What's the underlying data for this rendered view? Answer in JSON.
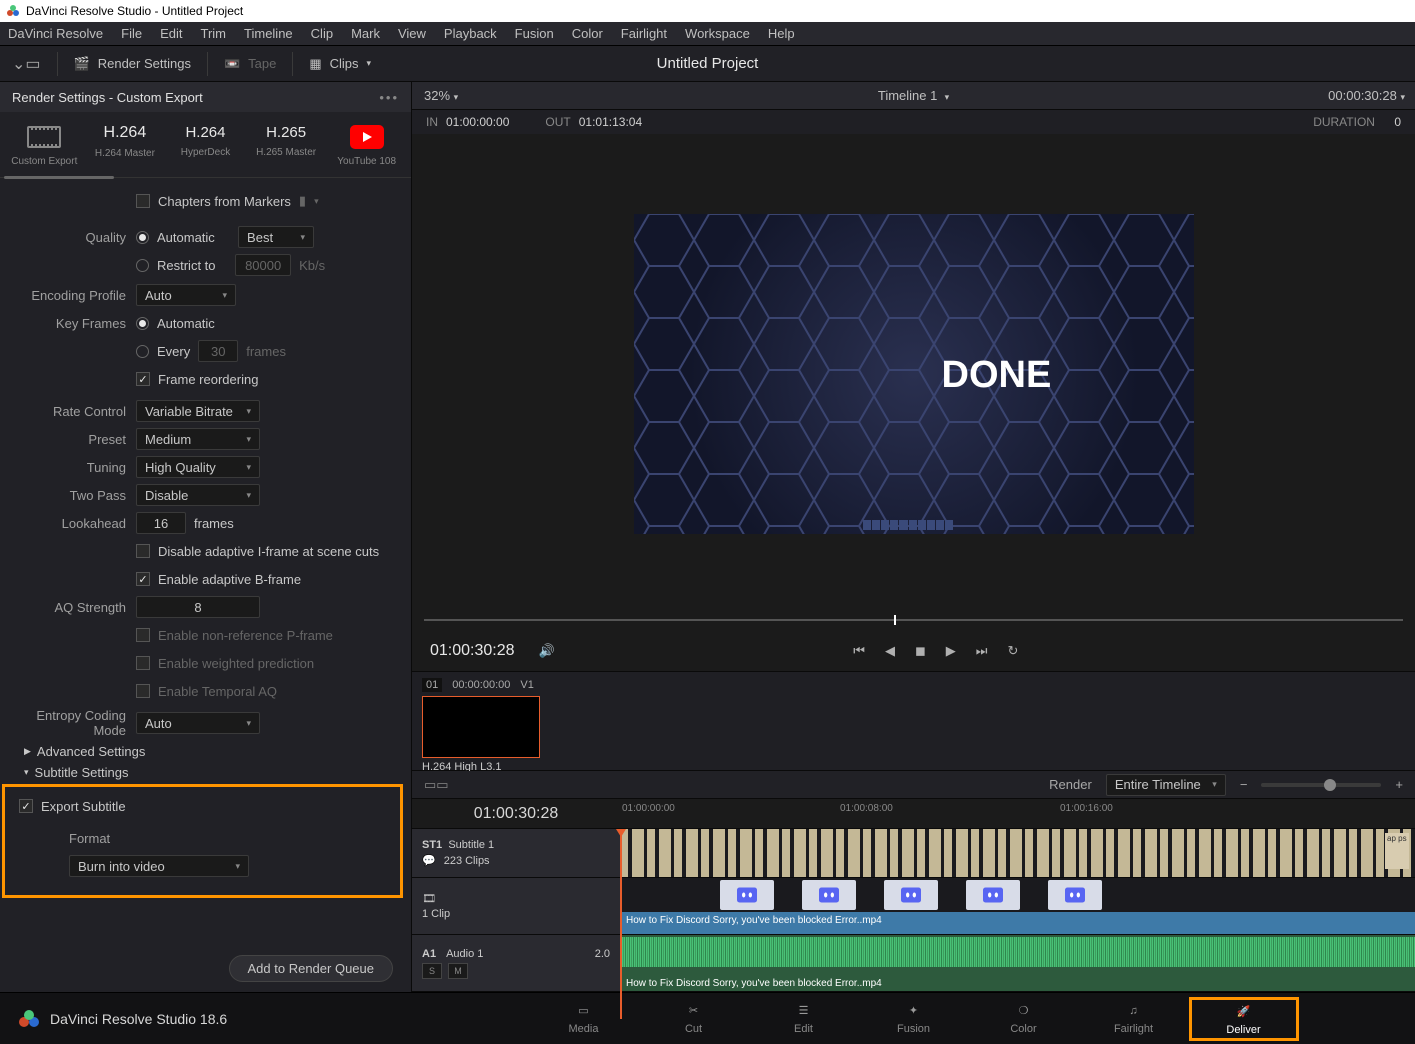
{
  "titlebar": {
    "text": "DaVinci Resolve Studio - Untitled Project"
  },
  "menubar": [
    "DaVinci Resolve",
    "File",
    "Edit",
    "Trim",
    "Timeline",
    "Clip",
    "Mark",
    "View",
    "Playback",
    "Fusion",
    "Color",
    "Fairlight",
    "Workspace",
    "Help"
  ],
  "toolbar": {
    "render_settings": "Render Settings",
    "tape": "Tape",
    "clips": "Clips",
    "project_title": "Untitled Project"
  },
  "render_settings": {
    "header": "Render Settings - Custom Export",
    "presets": [
      {
        "label": "Custom Export"
      },
      {
        "code": "H.264",
        "label": "H.264 Master"
      },
      {
        "code": "H.264",
        "label": "HyperDeck"
      },
      {
        "code": "H.265",
        "label": "H.265 Master"
      },
      {
        "label": "YouTube 108"
      }
    ],
    "chapters_from_markers": "Chapters from Markers",
    "quality_label": "Quality",
    "quality_automatic": "Automatic",
    "quality_best": "Best",
    "quality_restrict": "Restrict to",
    "quality_restrict_value": "80000",
    "quality_kbs": "Kb/s",
    "encoding_profile_label": "Encoding Profile",
    "encoding_profile_value": "Auto",
    "keyframes_label": "Key Frames",
    "keyframes_automatic": "Automatic",
    "keyframes_every": "Every",
    "keyframes_every_value": "30",
    "keyframes_frames": "frames",
    "frame_reordering": "Frame reordering",
    "rate_control_label": "Rate Control",
    "rate_control_value": "Variable Bitrate",
    "preset_label": "Preset",
    "preset_value": "Medium",
    "tuning_label": "Tuning",
    "tuning_value": "High Quality",
    "two_pass_label": "Two Pass",
    "two_pass_value": "Disable",
    "lookahead_label": "Lookahead",
    "lookahead_value": "16",
    "lookahead_frames": "frames",
    "disable_adaptive_i": "Disable adaptive I-frame at scene cuts",
    "enable_adaptive_b": "Enable adaptive B-frame",
    "aq_strength_label": "AQ Strength",
    "aq_strength_value": "8",
    "enable_nonref_p": "Enable non-reference P-frame",
    "enable_weighted": "Enable weighted prediction",
    "enable_temporal_aq": "Enable Temporal AQ",
    "entropy_label": "Entropy Coding Mode",
    "entropy_value": "Auto",
    "advanced_settings": "Advanced Settings",
    "subtitle_settings": "Subtitle Settings",
    "export_subtitle": "Export Subtitle",
    "format_label": "Format",
    "format_value": "Burn into video",
    "add_to_queue": "Add to Render Queue"
  },
  "viewer": {
    "zoom": "32%",
    "timeline_name": "Timeline 1",
    "right_timecode": "00:00:30:28",
    "in_label": "IN",
    "in_tc": "01:00:00:00",
    "out_label": "OUT",
    "out_tc": "01:01:13:04",
    "duration_label": "DURATION",
    "canvas_text": "DONE",
    "transport_tc": "01:00:30:28"
  },
  "clip": {
    "index": "01",
    "tc": "00:00:00:00",
    "track": "V1",
    "format": "H.264 High L3.1"
  },
  "timeline": {
    "render_label": "Render",
    "render_range": "Entire Timeline",
    "ruler_tc": "01:00:30:28",
    "ticks": [
      "01:00:00:00",
      "01:00:08:00",
      "01:00:16:00"
    ],
    "st1": {
      "id": "ST1",
      "name": "Subtitle 1",
      "clips": "223 Clips",
      "apps": "ap ps"
    },
    "v1": {
      "clips": "1 Clip",
      "clip_name": "How to Fix Discord Sorry, you've been blocked Error..mp4"
    },
    "a1": {
      "id": "A1",
      "name": "Audio 1",
      "meter": "2.0",
      "s": "S",
      "m": "M",
      "clip_name": "How to Fix Discord Sorry, you've been blocked Error..mp4"
    }
  },
  "page_tabs": {
    "brand": "DaVinci Resolve Studio 18.6",
    "tabs": [
      "Media",
      "Cut",
      "Edit",
      "Fusion",
      "Color",
      "Fairlight",
      "Deliver"
    ]
  }
}
